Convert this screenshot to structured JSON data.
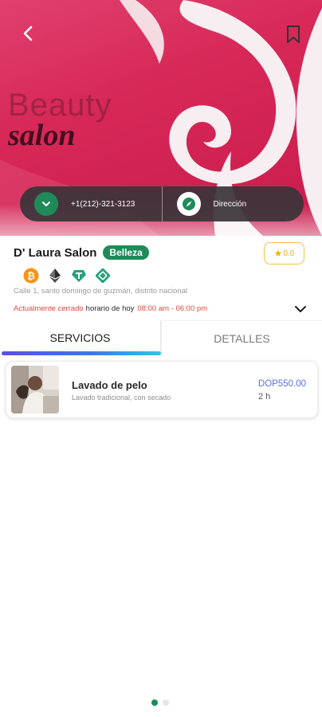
{
  "hero": {
    "brand_line1": "Beauty",
    "brand_line2": "salon"
  },
  "contact": {
    "phone": "+1(212)-321-3123",
    "directions_label": "Dirección"
  },
  "business": {
    "name": "D' Laura Salon",
    "category": "Belleza",
    "rating": "0.0",
    "payment_icons": [
      "bitcoin-icon",
      "ethereum-icon",
      "tether-icon",
      "bnb-icon"
    ],
    "address": "Calle 1, santo domingo de guzmán, distrito nacional",
    "status": "Actualmente cerrado",
    "hours_label": "horario de hoy",
    "hours_range": "08:00 am - 06:00 pm"
  },
  "tabs": [
    {
      "label": "SERVICIOS",
      "active": true
    },
    {
      "label": "DETALLES",
      "active": false
    }
  ],
  "services": [
    {
      "title": "Lavado de pelo",
      "description": "Lavado tradicional, con secado",
      "price": "DOP550.00",
      "duration": "2 h"
    }
  ],
  "pager": {
    "count": 2,
    "active_index": 0
  },
  "colors": {
    "brand_green": "#1f8a5a",
    "hero_pink": "#d72858",
    "closed_red": "#e0473b",
    "price_blue": "#5a72d8",
    "rating_gold": "#f5b400"
  }
}
